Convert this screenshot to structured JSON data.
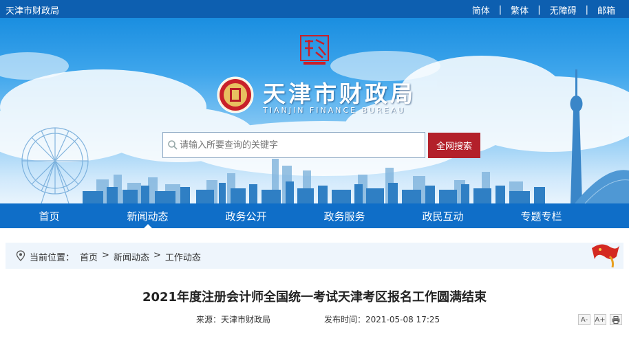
{
  "header": {
    "site_name": "天津市财政局",
    "links": [
      "简体",
      "繁体",
      "无障碍",
      "邮箱"
    ]
  },
  "banner": {
    "seal_icon": "tianjin-seal-icon",
    "emblem_icon": "finance-bureau-emblem-icon",
    "title_cn": "天津市财政局",
    "title_en": "TIANJIN FINANCE BUREAU"
  },
  "search": {
    "placeholder": "请输入所要查询的关键字",
    "button_label": "全网搜索",
    "button_color": "#b3202a"
  },
  "nav": {
    "items": [
      "首页",
      "新闻动态",
      "政务公开",
      "政务服务",
      "政民互动",
      "专题专栏"
    ],
    "active": "新闻动态",
    "color": "#0f6ec8"
  },
  "breadcrumb": {
    "label": "当前位置：",
    "items": [
      "首页",
      "新闻动态",
      "工作动态"
    ],
    "separator": ">"
  },
  "article": {
    "title": "2021年度注册会计师全国统一考试天津考区报名工作圆满结束",
    "source": "来源：天津市财政局",
    "published": "发布时间：2021-05-08 17:25",
    "tools": [
      "A-",
      "A+",
      "print-icon"
    ]
  },
  "colors": {
    "topbar": "#0d5fb0",
    "accent_red": "#b3202a"
  }
}
